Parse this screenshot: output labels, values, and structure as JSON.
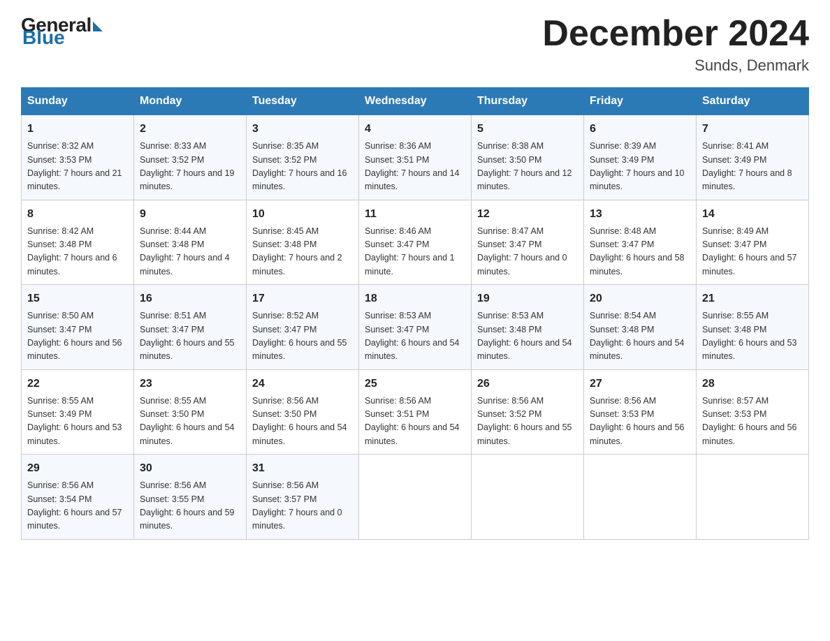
{
  "header": {
    "logo_general": "General",
    "logo_blue": "Blue",
    "month_title": "December 2024",
    "location": "Sunds, Denmark"
  },
  "days_of_week": [
    "Sunday",
    "Monday",
    "Tuesday",
    "Wednesday",
    "Thursday",
    "Friday",
    "Saturday"
  ],
  "weeks": [
    [
      {
        "day": "1",
        "sunrise": "Sunrise: 8:32 AM",
        "sunset": "Sunset: 3:53 PM",
        "daylight": "Daylight: 7 hours and 21 minutes."
      },
      {
        "day": "2",
        "sunrise": "Sunrise: 8:33 AM",
        "sunset": "Sunset: 3:52 PM",
        "daylight": "Daylight: 7 hours and 19 minutes."
      },
      {
        "day": "3",
        "sunrise": "Sunrise: 8:35 AM",
        "sunset": "Sunset: 3:52 PM",
        "daylight": "Daylight: 7 hours and 16 minutes."
      },
      {
        "day": "4",
        "sunrise": "Sunrise: 8:36 AM",
        "sunset": "Sunset: 3:51 PM",
        "daylight": "Daylight: 7 hours and 14 minutes."
      },
      {
        "day": "5",
        "sunrise": "Sunrise: 8:38 AM",
        "sunset": "Sunset: 3:50 PM",
        "daylight": "Daylight: 7 hours and 12 minutes."
      },
      {
        "day": "6",
        "sunrise": "Sunrise: 8:39 AM",
        "sunset": "Sunset: 3:49 PM",
        "daylight": "Daylight: 7 hours and 10 minutes."
      },
      {
        "day": "7",
        "sunrise": "Sunrise: 8:41 AM",
        "sunset": "Sunset: 3:49 PM",
        "daylight": "Daylight: 7 hours and 8 minutes."
      }
    ],
    [
      {
        "day": "8",
        "sunrise": "Sunrise: 8:42 AM",
        "sunset": "Sunset: 3:48 PM",
        "daylight": "Daylight: 7 hours and 6 minutes."
      },
      {
        "day": "9",
        "sunrise": "Sunrise: 8:44 AM",
        "sunset": "Sunset: 3:48 PM",
        "daylight": "Daylight: 7 hours and 4 minutes."
      },
      {
        "day": "10",
        "sunrise": "Sunrise: 8:45 AM",
        "sunset": "Sunset: 3:48 PM",
        "daylight": "Daylight: 7 hours and 2 minutes."
      },
      {
        "day": "11",
        "sunrise": "Sunrise: 8:46 AM",
        "sunset": "Sunset: 3:47 PM",
        "daylight": "Daylight: 7 hours and 1 minute."
      },
      {
        "day": "12",
        "sunrise": "Sunrise: 8:47 AM",
        "sunset": "Sunset: 3:47 PM",
        "daylight": "Daylight: 7 hours and 0 minutes."
      },
      {
        "day": "13",
        "sunrise": "Sunrise: 8:48 AM",
        "sunset": "Sunset: 3:47 PM",
        "daylight": "Daylight: 6 hours and 58 minutes."
      },
      {
        "day": "14",
        "sunrise": "Sunrise: 8:49 AM",
        "sunset": "Sunset: 3:47 PM",
        "daylight": "Daylight: 6 hours and 57 minutes."
      }
    ],
    [
      {
        "day": "15",
        "sunrise": "Sunrise: 8:50 AM",
        "sunset": "Sunset: 3:47 PM",
        "daylight": "Daylight: 6 hours and 56 minutes."
      },
      {
        "day": "16",
        "sunrise": "Sunrise: 8:51 AM",
        "sunset": "Sunset: 3:47 PM",
        "daylight": "Daylight: 6 hours and 55 minutes."
      },
      {
        "day": "17",
        "sunrise": "Sunrise: 8:52 AM",
        "sunset": "Sunset: 3:47 PM",
        "daylight": "Daylight: 6 hours and 55 minutes."
      },
      {
        "day": "18",
        "sunrise": "Sunrise: 8:53 AM",
        "sunset": "Sunset: 3:47 PM",
        "daylight": "Daylight: 6 hours and 54 minutes."
      },
      {
        "day": "19",
        "sunrise": "Sunrise: 8:53 AM",
        "sunset": "Sunset: 3:48 PM",
        "daylight": "Daylight: 6 hours and 54 minutes."
      },
      {
        "day": "20",
        "sunrise": "Sunrise: 8:54 AM",
        "sunset": "Sunset: 3:48 PM",
        "daylight": "Daylight: 6 hours and 54 minutes."
      },
      {
        "day": "21",
        "sunrise": "Sunrise: 8:55 AM",
        "sunset": "Sunset: 3:48 PM",
        "daylight": "Daylight: 6 hours and 53 minutes."
      }
    ],
    [
      {
        "day": "22",
        "sunrise": "Sunrise: 8:55 AM",
        "sunset": "Sunset: 3:49 PM",
        "daylight": "Daylight: 6 hours and 53 minutes."
      },
      {
        "day": "23",
        "sunrise": "Sunrise: 8:55 AM",
        "sunset": "Sunset: 3:50 PM",
        "daylight": "Daylight: 6 hours and 54 minutes."
      },
      {
        "day": "24",
        "sunrise": "Sunrise: 8:56 AM",
        "sunset": "Sunset: 3:50 PM",
        "daylight": "Daylight: 6 hours and 54 minutes."
      },
      {
        "day": "25",
        "sunrise": "Sunrise: 8:56 AM",
        "sunset": "Sunset: 3:51 PM",
        "daylight": "Daylight: 6 hours and 54 minutes."
      },
      {
        "day": "26",
        "sunrise": "Sunrise: 8:56 AM",
        "sunset": "Sunset: 3:52 PM",
        "daylight": "Daylight: 6 hours and 55 minutes."
      },
      {
        "day": "27",
        "sunrise": "Sunrise: 8:56 AM",
        "sunset": "Sunset: 3:53 PM",
        "daylight": "Daylight: 6 hours and 56 minutes."
      },
      {
        "day": "28",
        "sunrise": "Sunrise: 8:57 AM",
        "sunset": "Sunset: 3:53 PM",
        "daylight": "Daylight: 6 hours and 56 minutes."
      }
    ],
    [
      {
        "day": "29",
        "sunrise": "Sunrise: 8:56 AM",
        "sunset": "Sunset: 3:54 PM",
        "daylight": "Daylight: 6 hours and 57 minutes."
      },
      {
        "day": "30",
        "sunrise": "Sunrise: 8:56 AM",
        "sunset": "Sunset: 3:55 PM",
        "daylight": "Daylight: 6 hours and 59 minutes."
      },
      {
        "day": "31",
        "sunrise": "Sunrise: 8:56 AM",
        "sunset": "Sunset: 3:57 PM",
        "daylight": "Daylight: 7 hours and 0 minutes."
      },
      null,
      null,
      null,
      null
    ]
  ]
}
